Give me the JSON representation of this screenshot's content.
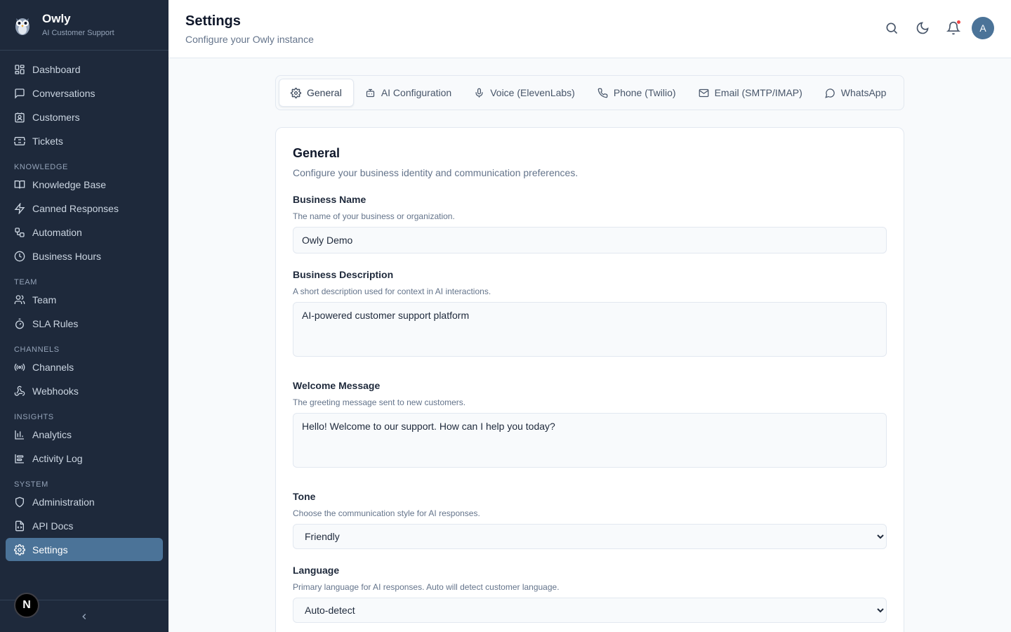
{
  "brand": {
    "name": "Owly",
    "subtitle": "AI Customer Support"
  },
  "nav": {
    "main": [
      {
        "label": "Dashboard",
        "icon": "dashboard-icon"
      },
      {
        "label": "Conversations",
        "icon": "chat-icon"
      },
      {
        "label": "Customers",
        "icon": "contact-icon"
      },
      {
        "label": "Tickets",
        "icon": "ticket-icon"
      }
    ],
    "knowledge_title": "KNOWLEDGE",
    "knowledge": [
      {
        "label": "Knowledge Base",
        "icon": "book-icon"
      },
      {
        "label": "Canned Responses",
        "icon": "bolt-icon"
      },
      {
        "label": "Automation",
        "icon": "workflow-icon"
      },
      {
        "label": "Business Hours",
        "icon": "clock-icon"
      }
    ],
    "team_title": "TEAM",
    "team": [
      {
        "label": "Team",
        "icon": "users-icon"
      },
      {
        "label": "SLA Rules",
        "icon": "timer-icon"
      }
    ],
    "channels_title": "CHANNELS",
    "channels": [
      {
        "label": "Channels",
        "icon": "radio-icon"
      },
      {
        "label": "Webhooks",
        "icon": "webhook-icon"
      }
    ],
    "insights_title": "INSIGHTS",
    "insights": [
      {
        "label": "Analytics",
        "icon": "bar-chart-icon"
      },
      {
        "label": "Activity Log",
        "icon": "log-icon"
      }
    ],
    "system_title": "SYSTEM",
    "system": [
      {
        "label": "Administration",
        "icon": "shield-icon"
      },
      {
        "label": "API Docs",
        "icon": "file-code-icon"
      },
      {
        "label": "Settings",
        "icon": "gear-icon",
        "active": true
      }
    ]
  },
  "header": {
    "title": "Settings",
    "subtitle": "Configure your Owly instance",
    "avatar": "A"
  },
  "tabs": [
    {
      "label": "General",
      "icon": "gear-icon",
      "active": true
    },
    {
      "label": "AI Configuration",
      "icon": "bot-icon"
    },
    {
      "label": "Voice (ElevenLabs)",
      "icon": "mic-icon"
    },
    {
      "label": "Phone (Twilio)",
      "icon": "phone-icon"
    },
    {
      "label": "Email (SMTP/IMAP)",
      "icon": "mail-icon"
    },
    {
      "label": "WhatsApp",
      "icon": "message-circle-icon"
    }
  ],
  "general": {
    "title": "General",
    "description": "Configure your business identity and communication preferences.",
    "business_name": {
      "label": "Business Name",
      "help": "The name of your business or organization.",
      "value": "Owly Demo"
    },
    "business_description": {
      "label": "Business Description",
      "help": "A short description used for context in AI interactions.",
      "value": "AI-powered customer support platform"
    },
    "welcome_message": {
      "label": "Welcome Message",
      "help": "The greeting message sent to new customers.",
      "value": "Hello! Welcome to our support. How can I help you today?"
    },
    "tone": {
      "label": "Tone",
      "help": "Choose the communication style for AI responses.",
      "value": "Friendly"
    },
    "language": {
      "label": "Language",
      "help": "Primary language for AI responses. Auto will detect customer language.",
      "value": "Auto-detect"
    }
  },
  "colors": {
    "sidebar_bg": "#1e293b",
    "active_nav": "#4b7398",
    "notification": "#ef4444"
  }
}
